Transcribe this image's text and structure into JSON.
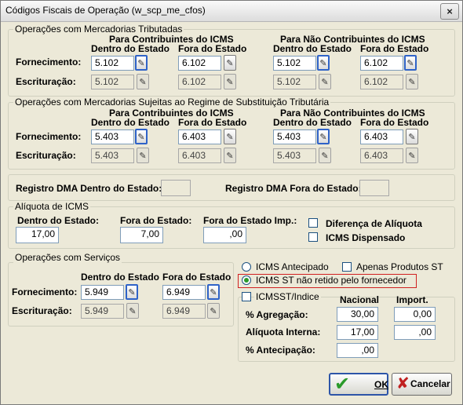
{
  "window": {
    "title": "Códigos Fiscais de Operação (w_scp_me_cfos)",
    "close_label": "×"
  },
  "trib": {
    "group_title": "Operações com Mercadorias Tributadas",
    "contrib_header": "Para Contribuintes do ICMS",
    "noncontrib_header": "Para Não Contribuintes do ICMS",
    "dentro": "Dentro do Estado",
    "fora": "Fora do Estado",
    "fornecimento_label": "Fornecimento:",
    "escrituracao_label": "Escrituração:",
    "forn": {
      "c_dentro": "5.102",
      "c_fora": "6.102",
      "n_dentro": "5.102",
      "n_fora": "6.102"
    },
    "escr": {
      "c_dentro": "5.102",
      "c_fora": "6.102",
      "n_dentro": "5.102",
      "n_fora": "6.102"
    }
  },
  "subst": {
    "group_title": "Operações com Mercadorias Sujeitas ao Regime de Substituição Tributária",
    "contrib_header": "Para Contribuintes do ICMS",
    "noncontrib_header": "Para Não Contribuintes do ICMS",
    "dentro": "Dentro do Estado",
    "fora": "Fora do Estado",
    "fornecimento_label": "Fornecimento:",
    "escrituracao_label": "Escrituração:",
    "forn": {
      "c_dentro": "5.403",
      "c_fora": "6.403",
      "n_dentro": "5.403",
      "n_fora": "6.403"
    },
    "escr": {
      "c_dentro": "5.403",
      "c_fora": "6.403",
      "n_dentro": "5.403",
      "n_fora": "6.403"
    }
  },
  "dma": {
    "dentro_label": "Registro DMA Dentro do Estado:",
    "fora_label": "Registro DMA Fora do Estado:",
    "dentro_value": "",
    "fora_value": ""
  },
  "aliq": {
    "group_title": "Alíquota de ICMS",
    "dentro_label": "Dentro do Estado:",
    "dentro_value": "17,00",
    "fora_label": "Fora do Estado:",
    "fora_value": "7,00",
    "fora_imp_label": "Fora do Estado Imp.:",
    "fora_imp_value": ",00",
    "diferenca_label": "Diferença de Alíquota",
    "dispensado_label": "ICMS Dispensado"
  },
  "serv": {
    "group_title": "Operações com Serviços",
    "dentro": "Dentro do Estado",
    "fora": "Fora do Estado",
    "fornecimento_label": "Fornecimento:",
    "escrituracao_label": "Escrituração:",
    "forn_dentro": "5.949",
    "forn_fora": "6.949",
    "escr_dentro": "5.949",
    "escr_fora": "6.949"
  },
  "icms": {
    "antecipado_label": "ICMS Antecipado",
    "apenas_label": "Apenas Produtos ST",
    "st_nao_retido_label": "ICMS ST não retido pelo fornecedor",
    "icmsst_label": "ICMSST/Indice",
    "nacional_header": "Nacional",
    "import_header": "Import.",
    "agregacao_label": "% Agregação:",
    "agregacao_nac": "30,00",
    "agregacao_imp": "0,00",
    "aliq_interna_label": "Alíquota Interna:",
    "aliq_interna_nac": "17,00",
    "aliq_interna_imp": ",00",
    "antecipacao_label": "% Antecipação:",
    "antecipacao_nac": ",00"
  },
  "buttons": {
    "ok_label": "OK",
    "cancel_label": "Cancelar"
  },
  "colors": {
    "accent_focus": "#2f63c8",
    "highlight_border": "#d02020",
    "ok_check": "#2a9a2a",
    "cancel_x": "#c02020"
  }
}
